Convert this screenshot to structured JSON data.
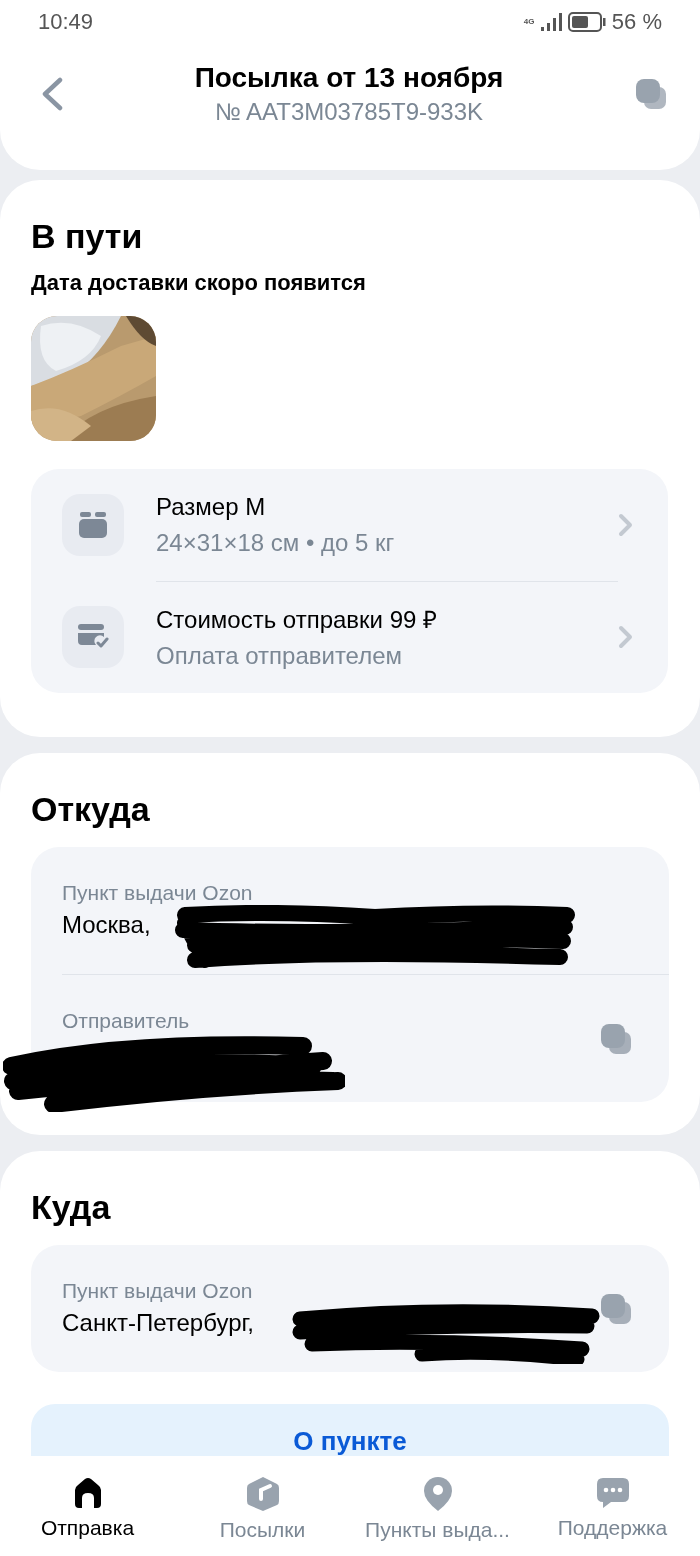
{
  "status_bar": {
    "time": "10:49",
    "network": "4G",
    "battery": "56 %"
  },
  "header": {
    "title": "Посылка от 13 ноября",
    "subtitle": "№ AAT3M03785T9-933K"
  },
  "status_card": {
    "title": "В пути",
    "subtitle": "Дата доставки скоро появится",
    "details": [
      {
        "kind": "box",
        "title": "Размер M",
        "subtitle": "24×31×18 см • до 5 кг"
      },
      {
        "kind": "payment",
        "title": "Стоимость отправки 99 ₽",
        "subtitle": "Оплата отправителем"
      }
    ]
  },
  "from_card": {
    "title": "Откуда",
    "rows": [
      {
        "label": "Пункт выдачи Ozon",
        "value": "Москва,"
      },
      {
        "label": "Отправитель",
        "copy": true
      }
    ]
  },
  "to_card": {
    "title": "Куда",
    "rows": [
      {
        "label": "Пункт выдачи Ozon",
        "value": "Санкт-Петербург,",
        "copy": true
      }
    ],
    "button": "О пункте"
  },
  "bottom_nav": [
    {
      "label": "Отправка",
      "selected": true
    },
    {
      "label": "Посылки",
      "selected": false
    },
    {
      "label": "Пункты выда...",
      "selected": false
    },
    {
      "label": "Поддержка",
      "selected": false
    }
  ]
}
